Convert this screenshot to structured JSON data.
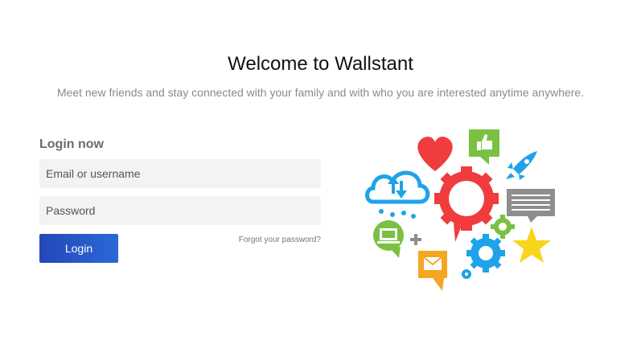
{
  "header": {
    "title": "Welcome to Wallstant",
    "subtitle": "Meet new friends and stay connected with your family and with who you are interested anytime anywhere."
  },
  "login": {
    "heading": "Login now",
    "email_placeholder": "Email or username",
    "password_placeholder": "Password",
    "submit_label": "Login",
    "forgot_label": "Forgot your password?"
  },
  "illustration": {
    "icons": [
      "heart-icon",
      "thumbs-up-icon",
      "rocket-icon",
      "cloud-sync-icon",
      "gear-icon",
      "chat-bubble-icon",
      "laptop-icon",
      "plus-icon",
      "mail-icon",
      "star-icon"
    ],
    "colors": {
      "red": "#f03c3c",
      "green": "#7ac143",
      "blue": "#1ea3e8",
      "orange": "#f5a623",
      "gray": "#8e8e8e",
      "yellow": "#f8d51c"
    }
  },
  "theme": {
    "button_gradient_start": "#2447b8",
    "button_gradient_end": "#2b68d8"
  }
}
